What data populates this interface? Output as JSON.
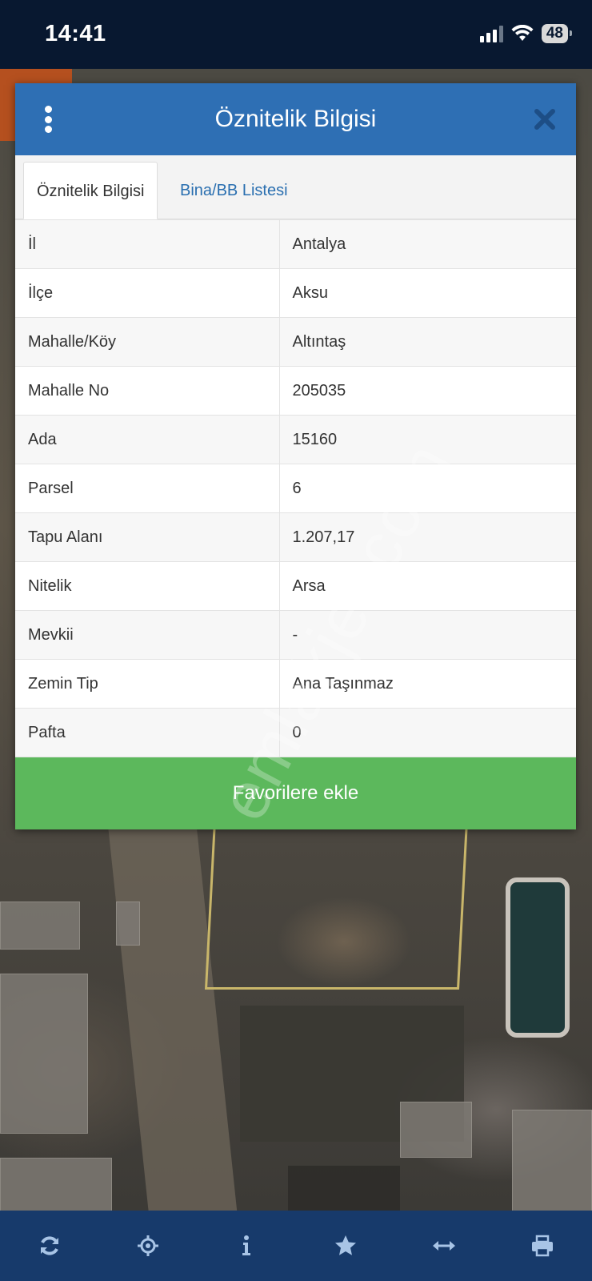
{
  "status_bar": {
    "time": "14:41",
    "battery": "48"
  },
  "dialog": {
    "title": "Öznitelik Bilgisi",
    "tabs": [
      {
        "label": "Öznitelik Bilgisi",
        "active": true
      },
      {
        "label": "Bina/BB Listesi",
        "active": false
      }
    ],
    "rows": [
      {
        "label": "İl",
        "value": "Antalya"
      },
      {
        "label": "İlçe",
        "value": "Aksu"
      },
      {
        "label": "Mahalle/Köy",
        "value": "Altıntaş"
      },
      {
        "label": "Mahalle No",
        "value": "205035"
      },
      {
        "label": "Ada",
        "value": "15160"
      },
      {
        "label": "Parsel",
        "value": "6"
      },
      {
        "label": "Tapu Alanı",
        "value": "1.207,17"
      },
      {
        "label": "Nitelik",
        "value": "Arsa"
      },
      {
        "label": "Mevkii",
        "value": "-"
      },
      {
        "label": "Zemin Tip",
        "value": "Ana Taşınmaz"
      },
      {
        "label": "Pafta",
        "value": "0"
      }
    ],
    "favorite_button": "Favorilere ekle"
  },
  "watermark": "emlakjet.com",
  "toolbar": {
    "icons": [
      "refresh-icon",
      "locate-icon",
      "info-icon",
      "star-icon",
      "measure-icon",
      "print-icon"
    ]
  },
  "colors": {
    "header": "#2e6fb4",
    "tab_link": "#2a6fb0",
    "button": "#5cb85c",
    "toolbar": "#173a6b",
    "toolbar_icon": "#a8c4e6"
  }
}
